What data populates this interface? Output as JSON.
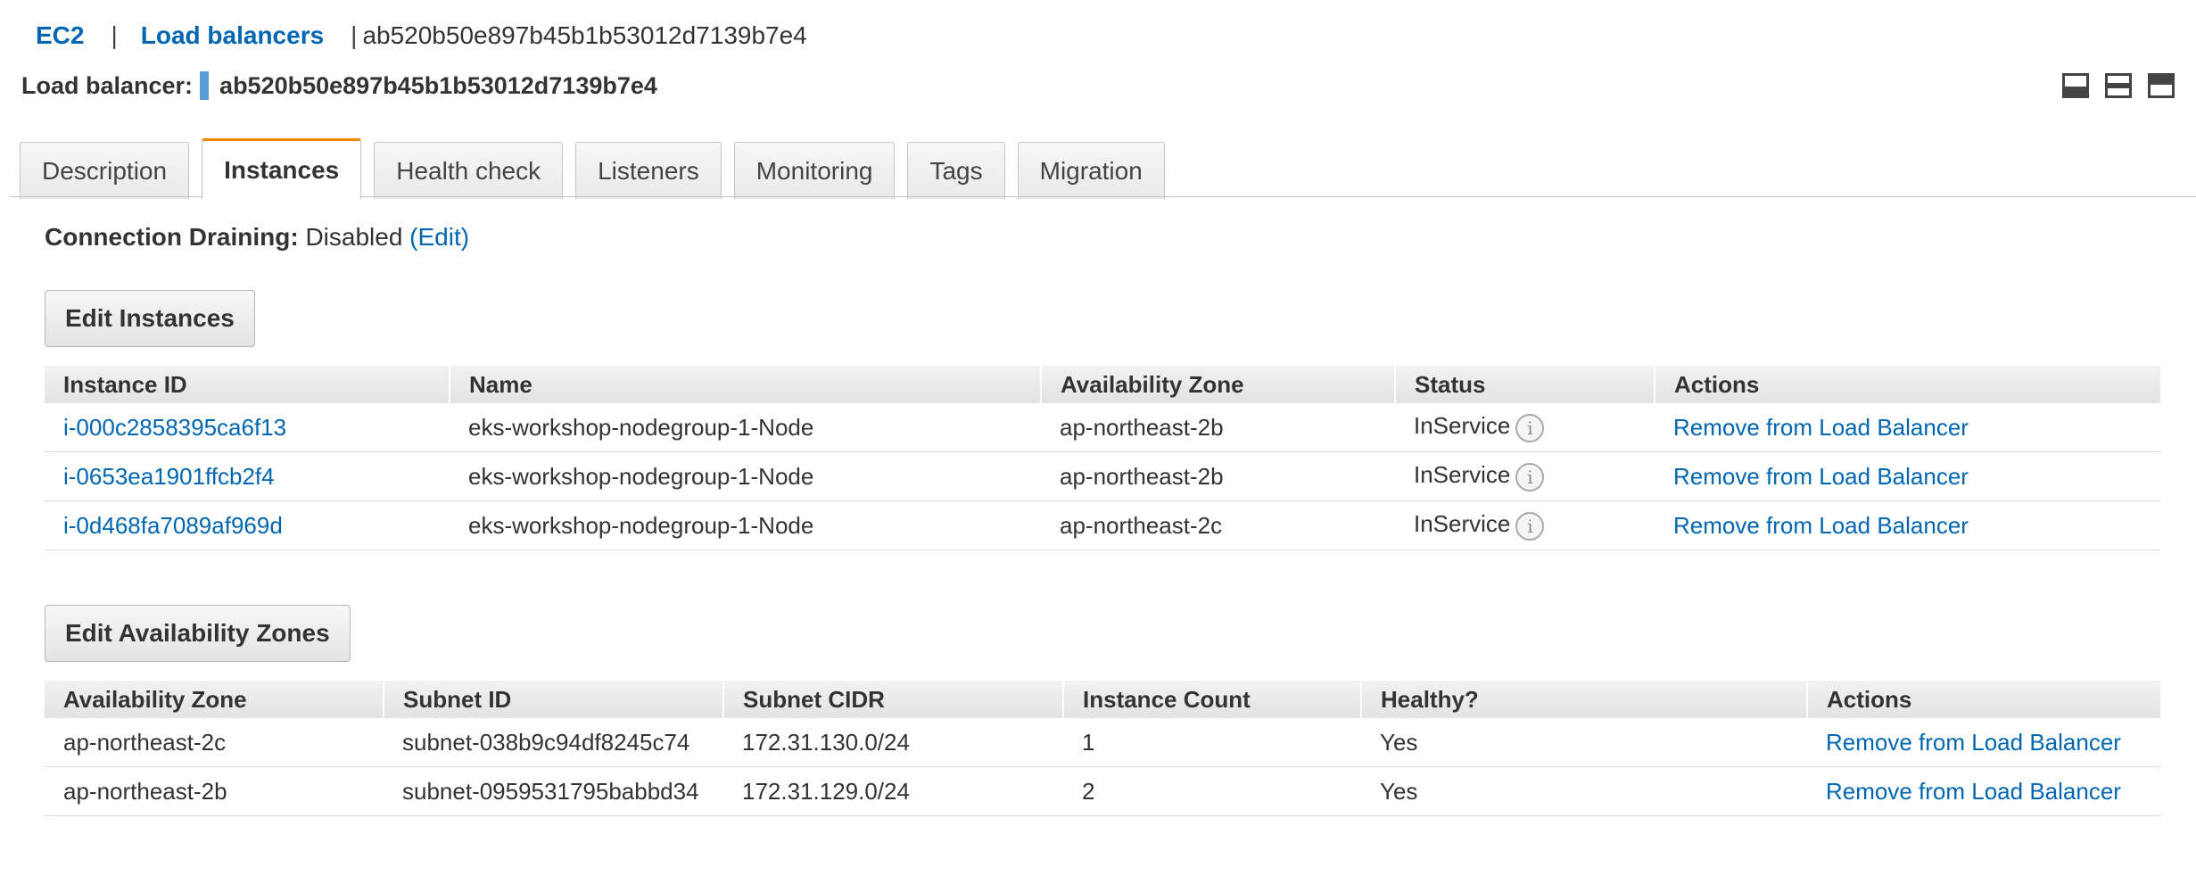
{
  "breadcrumb": {
    "ec2": "EC2",
    "sep1": "|",
    "load_balancers": "Load balancers",
    "sep2": "|",
    "current": "ab520b50e897b45b1b53012d7139b7e4"
  },
  "title": {
    "label": "Load balancer:",
    "name": "ab520b50e897b45b1b53012d7139b7e4"
  },
  "view_icons": [
    "panel-bottom-icon",
    "panel-split-icon",
    "panel-top-icon"
  ],
  "tabs": [
    {
      "label": "Description"
    },
    {
      "label": "Instances",
      "active": true
    },
    {
      "label": "Health check"
    },
    {
      "label": "Listeners"
    },
    {
      "label": "Monitoring"
    },
    {
      "label": "Tags"
    },
    {
      "label": "Migration"
    }
  ],
  "draining": {
    "label": "Connection Draining:",
    "value": "Disabled",
    "edit": "(Edit)"
  },
  "instances": {
    "button": "Edit Instances",
    "columns": [
      "Instance ID",
      "Name",
      "Availability Zone",
      "Status",
      "Actions"
    ],
    "rows": [
      {
        "id": "i-000c2858395ca6f13",
        "name": "eks-workshop-nodegroup-1-Node",
        "az": "ap-northeast-2b",
        "status": "InService",
        "action": "Remove from Load Balancer"
      },
      {
        "id": "i-0653ea1901ffcb2f4",
        "name": "eks-workshop-nodegroup-1-Node",
        "az": "ap-northeast-2b",
        "status": "InService",
        "action": "Remove from Load Balancer"
      },
      {
        "id": "i-0d468fa7089af969d",
        "name": "eks-workshop-nodegroup-1-Node",
        "az": "ap-northeast-2c",
        "status": "InService",
        "action": "Remove from Load Balancer"
      }
    ]
  },
  "zones": {
    "button": "Edit Availability Zones",
    "columns": [
      "Availability Zone",
      "Subnet ID",
      "Subnet CIDR",
      "Instance Count",
      "Healthy?",
      "Actions"
    ],
    "rows": [
      {
        "az": "ap-northeast-2c",
        "subnet": "subnet-038b9c94df8245c74",
        "cidr": "172.31.130.0/24",
        "count": "1",
        "healthy": "Yes",
        "action": "Remove from Load Balancer"
      },
      {
        "az": "ap-northeast-2b",
        "subnet": "subnet-0959531795babbd34",
        "cidr": "172.31.129.0/24",
        "count": "2",
        "healthy": "Yes",
        "action": "Remove from Load Balancer"
      }
    ]
  },
  "colors": {
    "link": "#0066b2",
    "active_tab_accent": "#f08c00",
    "title_marker": "#5b9bd5"
  }
}
